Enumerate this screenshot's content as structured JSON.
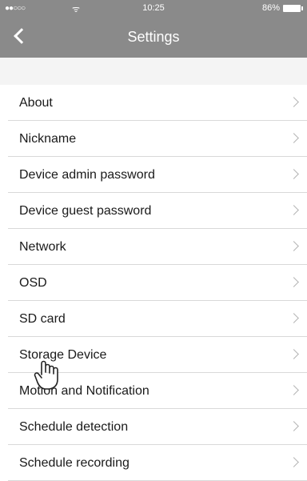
{
  "status": {
    "signal": "●●○○○",
    "wifi": "ᯤ",
    "time": "10:25",
    "battery": "86%"
  },
  "header": {
    "title": "Settings"
  },
  "settings": {
    "items": [
      {
        "label": "About"
      },
      {
        "label": "Nickname"
      },
      {
        "label": "Device admin password"
      },
      {
        "label": "Device guest password"
      },
      {
        "label": "Network"
      },
      {
        "label": "OSD"
      },
      {
        "label": "SD card"
      },
      {
        "label": "Storage Device"
      },
      {
        "label": "Motion and Notification"
      },
      {
        "label": "Schedule detection"
      },
      {
        "label": "Schedule recording"
      }
    ]
  },
  "icons": {
    "back": "chevron-left-icon",
    "row": "chevron-right-icon",
    "cursor": "hand-pointer-icon"
  }
}
